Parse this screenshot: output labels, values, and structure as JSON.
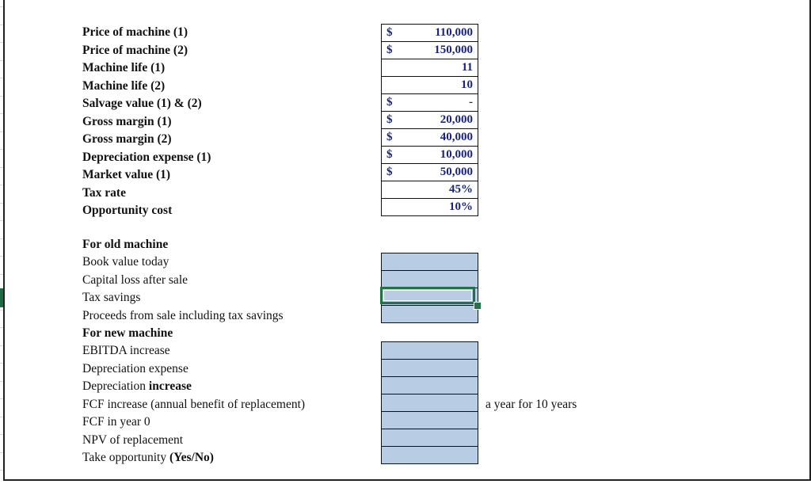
{
  "inputs": [
    {
      "label": "Price of machine (1)",
      "currency": "$",
      "value": "110,000"
    },
    {
      "label": "Price of machine (2)",
      "currency": "$",
      "value": "150,000"
    },
    {
      "label": "Machine life (1)",
      "currency": "",
      "value": "11"
    },
    {
      "label": "Machine life (2)",
      "currency": "",
      "value": "10"
    },
    {
      "label": "Salvage value (1) & (2)",
      "currency": "$",
      "value": "-"
    },
    {
      "label": "Gross margin (1)",
      "currency": "$",
      "value": "20,000"
    },
    {
      "label": "Gross margin (2)",
      "currency": "$",
      "value": "40,000"
    },
    {
      "label": "Depreciation expense (1)",
      "currency": "$",
      "value": "10,000"
    },
    {
      "label": "Market value (1)",
      "currency": "$",
      "value": "50,000"
    },
    {
      "label": "Tax rate",
      "currency": "",
      "value": "45%"
    },
    {
      "label": "Opportunity cost",
      "currency": "",
      "value": "10%"
    }
  ],
  "old_machine": {
    "heading": "For old machine",
    "rows": [
      {
        "label": "Book value today",
        "value": ""
      },
      {
        "label": "Capital loss after sale",
        "value": ""
      },
      {
        "label": "Tax savings",
        "value": ""
      },
      {
        "label": "Proceeds from sale including tax savings",
        "value": ""
      }
    ]
  },
  "new_machine": {
    "heading": "For new machine",
    "rows": [
      {
        "label": "EBITDA increase",
        "value": ""
      },
      {
        "label": "Depreciation expense",
        "value": ""
      },
      {
        "label": "Depreciation ",
        "label_bold": "increase",
        "value": ""
      },
      {
        "label": "FCF increase (annual benefit of replacement)",
        "value": ""
      },
      {
        "label": "FCF in year 0",
        "value": ""
      },
      {
        "label": "NPV of replacement",
        "value": ""
      },
      {
        "label": "Take opportunity ",
        "label_bold": "(Yes/No)",
        "value": ""
      }
    ],
    "note": "a year for 10 years"
  },
  "colors": {
    "value_text": "#1a237e",
    "answer_fill": "#b8cce4",
    "selection": "#217346"
  }
}
